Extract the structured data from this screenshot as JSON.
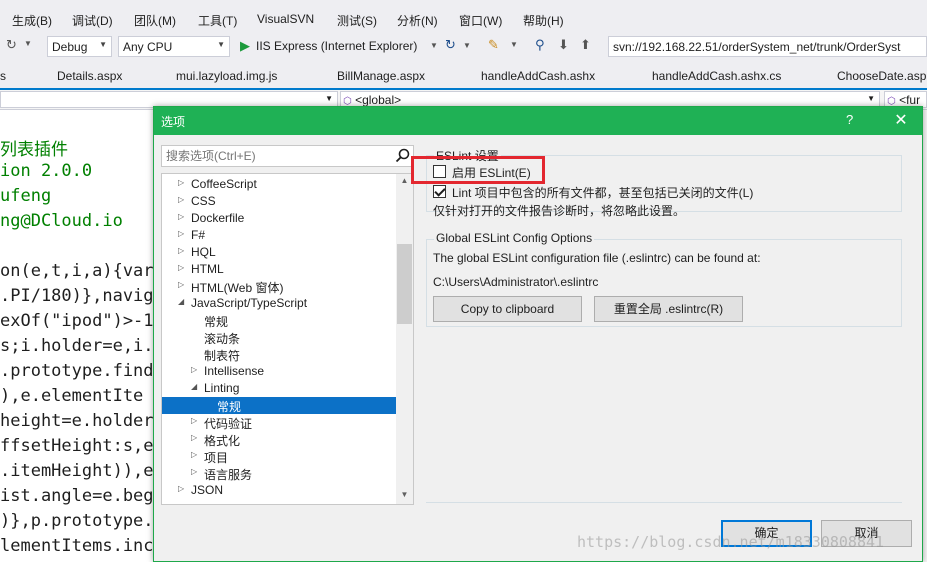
{
  "menu": {
    "items": [
      "生成(B)",
      "调试(D)",
      "团队(M)",
      "工具(T)",
      "VisualSVN",
      "测试(S)",
      "分析(N)",
      "窗口(W)",
      "帮助(H)"
    ]
  },
  "toolbar": {
    "config": "Debug",
    "platform": "Any CPU",
    "run_target": "IIS Express (Internet Explorer)",
    "svn_url": "svn://192.168.22.51/orderSystem_net/trunk/OrderSyst"
  },
  "tabs": [
    "s",
    "Details.aspx",
    "mui.lazyload.img.js",
    "BillManage.aspx",
    "handleAddCash.ashx",
    "handleAddCash.ashx.cs",
    "ChooseDate.asp"
  ],
  "navbar": {
    "scope": "<global>",
    "member": "<fur"
  },
  "code_lines": [
    "列表插件",
    "ion 2.0.0",
    "ufeng",
    "ng@DCloud.io",
    "on(e,t,i,a){var",
    ".PI/180)},navig",
    "exOf(\"ipod\")>-1",
    "s;i.holder=e,i.",
    ".prototype.find",
    "),e.elementIte",
    "height=e.holder",
    "ffsetHeight:s,e",
    ".itemHeight)),e",
    "ist.angle=e.beg",
    ")},p.prototype.",
    "lementItems.inc"
  ],
  "dialog": {
    "title": "选项",
    "help": "?",
    "close": "✕",
    "search_placeholder": "搜索选项(Ctrl+E)",
    "tree": [
      {
        "label": "CoffeeScript",
        "expander": "▷"
      },
      {
        "label": "CSS",
        "expander": "▷"
      },
      {
        "label": "Dockerfile",
        "expander": "▷"
      },
      {
        "label": "F#",
        "expander": "▷"
      },
      {
        "label": "HQL",
        "expander": "▷"
      },
      {
        "label": "HTML",
        "expander": "▷"
      },
      {
        "label": "HTML(Web 窗体)",
        "expander": "▷"
      },
      {
        "label": "JavaScript/TypeScript",
        "expander": "◢"
      },
      {
        "label": "常规",
        "expander": ""
      },
      {
        "label": "滚动条",
        "expander": ""
      },
      {
        "label": "制表符",
        "expander": ""
      },
      {
        "label": "Intellisense",
        "expander": "▷"
      },
      {
        "label": "Linting",
        "expander": "◢"
      },
      {
        "label": "常规",
        "expander": ""
      },
      {
        "label": "代码验证",
        "expander": "▷"
      },
      {
        "label": "格式化",
        "expander": "▷"
      },
      {
        "label": "项目",
        "expander": "▷"
      },
      {
        "label": "语言服务",
        "expander": "▷"
      },
      {
        "label": "JSON",
        "expander": "▷"
      }
    ],
    "eslint_group": "ESLint 设置",
    "enable_eslint": "启用 ESLint(E)",
    "lint_all_files": "Lint 项目中包含的所有文件都，甚至包括已关闭的文件(L)",
    "lint_note": "仅针对打开的文件报告诊断时，将忽略此设置。",
    "global_group": "Global ESLint Config Options",
    "global_desc": "The global ESLint configuration file (.eslintrc) can be found at:",
    "config_path": "C:\\Users\\Administrator\\.eslintrc",
    "copy_button": "Copy to clipboard",
    "reset_button": "重置全局 .eslintrc(R)",
    "ok_button": "确定",
    "cancel_button": "取消"
  },
  "watermark": "https://blog.csdn.net/m18330808841"
}
